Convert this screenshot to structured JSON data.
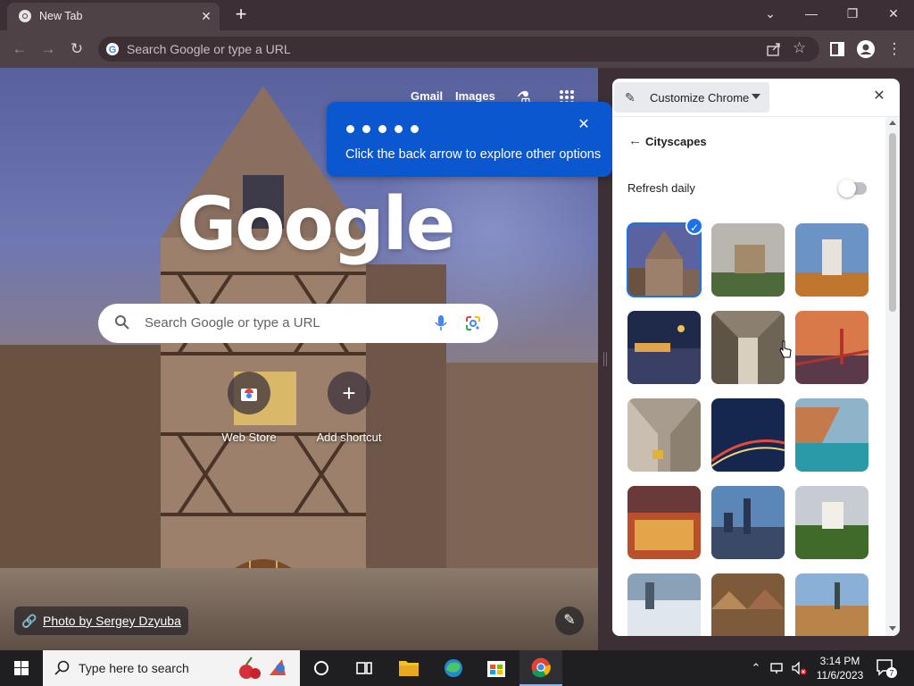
{
  "browser": {
    "tab_title": "New Tab",
    "omnibox_placeholder": "Search Google or type a URL"
  },
  "ntp": {
    "links": [
      "Gmail",
      "Images"
    ],
    "logo": "Google",
    "search_placeholder": "Search Google or type a URL",
    "shortcuts": [
      {
        "label": "Web Store",
        "icon": "web-store-icon"
      },
      {
        "label": "Add shortcut",
        "icon": "plus-icon"
      }
    ],
    "photo_credit": "Photo by Sergey Dzyuba"
  },
  "tooltip": {
    "text": "Click the back arrow to explore other options",
    "dot_count": 5
  },
  "side_panel": {
    "title": "Customize Chrome",
    "collection": "Cityscapes",
    "refresh_label": "Refresh daily",
    "refresh_enabled": false,
    "selected_index": 0,
    "thumbnail_count": 15
  },
  "taskbar": {
    "search_placeholder": "Type here to search",
    "time": "3:14 PM",
    "date": "11/6/2023",
    "notification_count": "7"
  },
  "colors": {
    "accent": "#0b57d0",
    "frame": "#3c2f35",
    "toolbar": "#4f4247"
  }
}
